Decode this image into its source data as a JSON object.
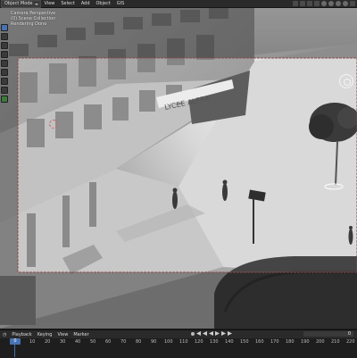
{
  "header": {
    "mode": "Object Mode",
    "menus": [
      "View",
      "Select",
      "Add",
      "Object",
      "GIS"
    ]
  },
  "viewport": {
    "info": [
      "Camera Perspective",
      "(0) Scene Collection",
      "Rendering Done"
    ],
    "sign_text": "LYCEE ALFRA"
  },
  "timeline": {
    "menus": [
      "Playback",
      "Keying",
      "View",
      "Marker"
    ],
    "current_frame": "0",
    "frame_field": "0",
    "ticks": [
      "0",
      "10",
      "20",
      "30",
      "40",
      "50",
      "60",
      "70",
      "80",
      "90",
      "100",
      "110",
      "120",
      "130",
      "140",
      "150",
      "160",
      "170",
      "180",
      "190",
      "200",
      "210",
      "220",
      "230",
      "240",
      "250"
    ]
  },
  "colors": {
    "header_bg": "#2a2a2a",
    "accent": "#4772b3",
    "camera_frame": "#8b4a4a"
  },
  "icons": [
    "object-mode-icon",
    "sidebar-toggle-icon",
    "viewport-shading-icon",
    "navigation-gizmo-icon",
    "3d-cursor-icon",
    "play-icon"
  ]
}
